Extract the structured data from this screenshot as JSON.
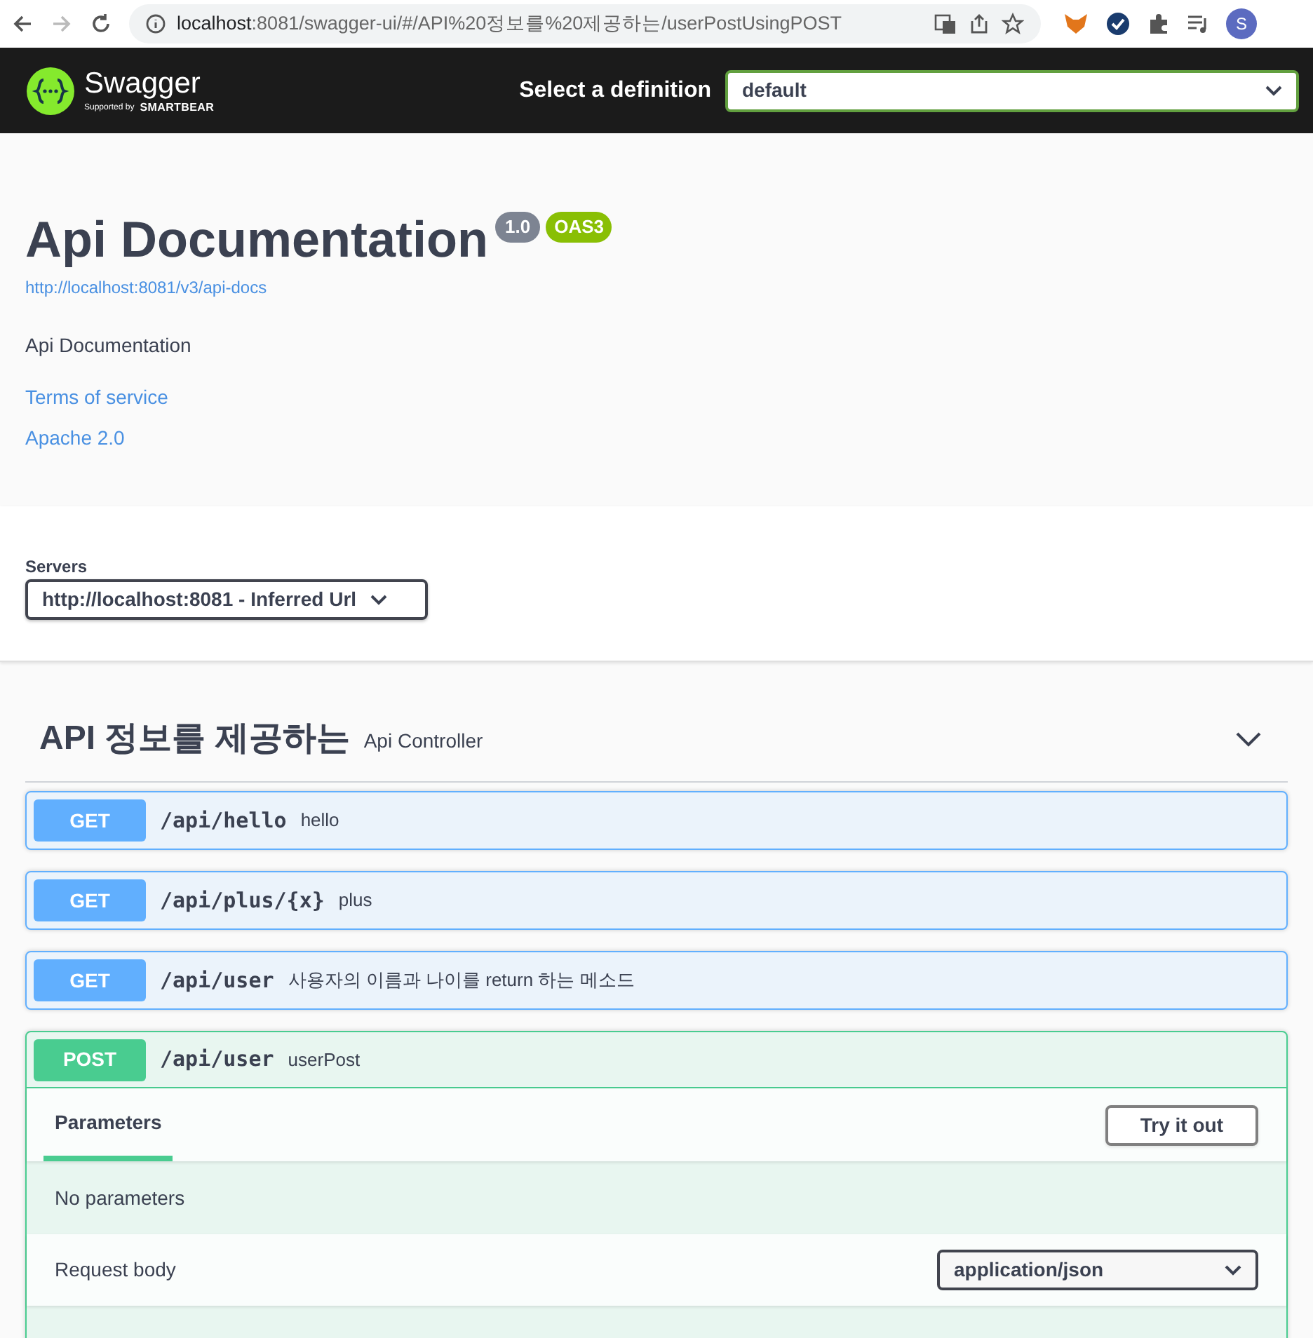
{
  "browser": {
    "url_host": "localhost",
    "url_rest": ":8081/swagger-ui/#/API%20정보를%20제공하는/userPostUsingPOST",
    "avatar": "S"
  },
  "header": {
    "logo": "Swagger",
    "logo_sub": "Supported by",
    "logo_brand": "SMARTBEAR",
    "definition_label": "Select a definition",
    "definition": "default"
  },
  "info": {
    "title": "Api Documentation",
    "version": "1.0",
    "spec": "OAS3",
    "spec_url": "http://localhost:8081/v3/api-docs",
    "description": "Api Documentation",
    "links": [
      "Terms of service",
      "Apache 2.0"
    ]
  },
  "servers": {
    "label": "Servers",
    "selected": "http://localhost:8081 - Inferred Url"
  },
  "tag": {
    "name": "API 정보를 제공하는",
    "description": "Api Controller",
    "expanded": true
  },
  "operations": [
    {
      "kind": "get",
      "method": "GET",
      "path": "/api/hello",
      "summary": "hello",
      "expanded": false
    },
    {
      "kind": "get",
      "method": "GET",
      "path": "/api/plus/{x}",
      "summary": "plus",
      "expanded": false
    },
    {
      "kind": "get",
      "method": "GET",
      "path": "/api/user",
      "summary": "사용자의 이름과 나이를 return 하는 메소드",
      "expanded": false
    },
    {
      "kind": "post",
      "method": "POST",
      "path": "/api/user",
      "summary": "userPost",
      "expanded": true,
      "tabs": [
        {
          "label": "Parameters",
          "selected": true
        }
      ],
      "try_button": "Try it out",
      "no_params": "No parameters",
      "request_body_label": "Request body",
      "content_type": "application/json"
    }
  ]
}
